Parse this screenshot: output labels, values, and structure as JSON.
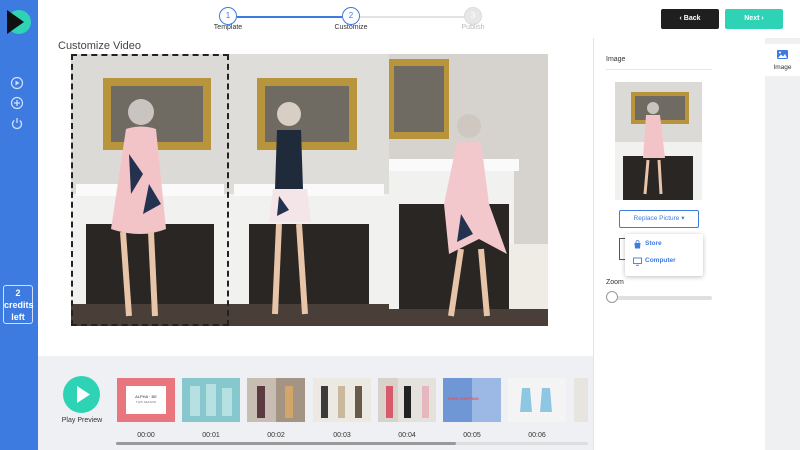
{
  "sidebar": {
    "credits_line1": "2",
    "credits_line2": "credits",
    "credits_line3": "left"
  },
  "steps": [
    {
      "number": "1",
      "label": "Template"
    },
    {
      "number": "2",
      "label": "Customize"
    },
    {
      "number": "3",
      "label": "Publish"
    }
  ],
  "toolbar": {
    "back_label": "Back",
    "next_label": "Next"
  },
  "main": {
    "title": "Customize Video"
  },
  "timeline": {
    "play_label": "Play Preview",
    "clips": [
      {
        "time": "00:00",
        "text1": "ALPHA · BE",
        "text2": "THIS SEASON"
      },
      {
        "time": "00:01"
      },
      {
        "time": "00:02"
      },
      {
        "time": "00:03"
      },
      {
        "time": "00:04"
      },
      {
        "time": "00:05",
        "text1": "FREE SHIPPING"
      },
      {
        "time": "00:06"
      }
    ]
  },
  "panel": {
    "section_title": "Image",
    "replace_label": "Replace Picture",
    "dropdown": [
      "Store",
      "Computer"
    ],
    "zoom_label": "Zoom"
  },
  "tabstrip": {
    "image_tab": "Image"
  },
  "colors": {
    "accent": "#3e7be0",
    "teal": "#2ed3b5",
    "dark": "#1f1f1f"
  }
}
